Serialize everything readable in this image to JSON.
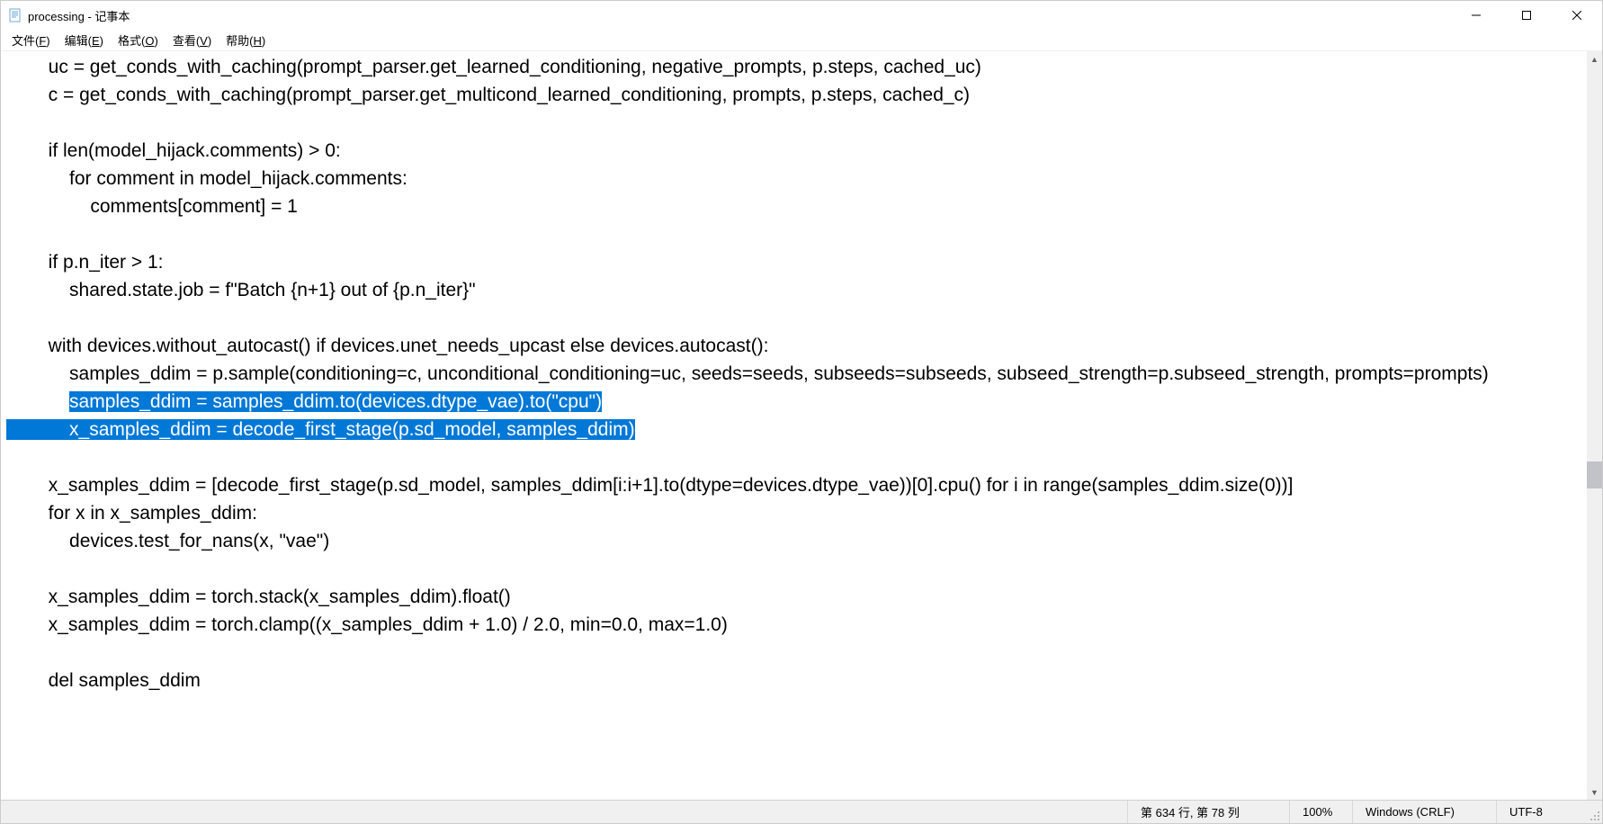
{
  "window": {
    "title": "processing - 记事本"
  },
  "menu": {
    "file": "文件(F)",
    "edit": "编辑(E)",
    "format": "格式(O)",
    "view": "查看(V)",
    "help": "帮助(H)"
  },
  "content": {
    "line1": "        uc = get_conds_with_caching(prompt_parser.get_learned_conditioning, negative_prompts, p.steps, cached_uc)",
    "line2": "        c = get_conds_with_caching(prompt_parser.get_multicond_learned_conditioning, prompts, p.steps, cached_c)",
    "line3": "",
    "line4": "        if len(model_hijack.comments) > 0:",
    "line5": "            for comment in model_hijack.comments:",
    "line6": "                comments[comment] = 1",
    "line7": "",
    "line8": "        if p.n_iter > 1:",
    "line9": "            shared.state.job = f\"Batch {n+1} out of {p.n_iter}\"",
    "line10": "",
    "line11": "        with devices.without_autocast() if devices.unet_needs_upcast else devices.autocast():",
    "line12": "            samples_ddim = p.sample(conditioning=c, unconditional_conditioning=uc, seeds=seeds, subseeds=subseeds, subseed_strength=p.subseed_strength, prompts=prompts)",
    "sel1_pre": "            ",
    "sel1": "samples_ddim = samples_ddim.to(devices.dtype_vae).to(\"cpu\")",
    "sel2_pre": "            ",
    "sel2": "x_samples_ddim = decode_first_stage(p.sd_model, samples_ddim)",
    "line15": "",
    "line16": "        x_samples_ddim = [decode_first_stage(p.sd_model, samples_ddim[i:i+1].to(dtype=devices.dtype_vae))[0].cpu() for i in range(samples_ddim.size(0))]",
    "line17": "        for x in x_samples_ddim:",
    "line18": "            devices.test_for_nans(x, \"vae\")",
    "line19": "",
    "line20": "        x_samples_ddim = torch.stack(x_samples_ddim).float()",
    "line21": "        x_samples_ddim = torch.clamp((x_samples_ddim + 1.0) / 2.0, min=0.0, max=1.0)",
    "line22": "",
    "line23": "        del samples_ddim"
  },
  "status": {
    "position": "第 634 行, 第 78 列",
    "zoom": "100%",
    "line_ending": "Windows (CRLF)",
    "encoding": "UTF-8"
  }
}
